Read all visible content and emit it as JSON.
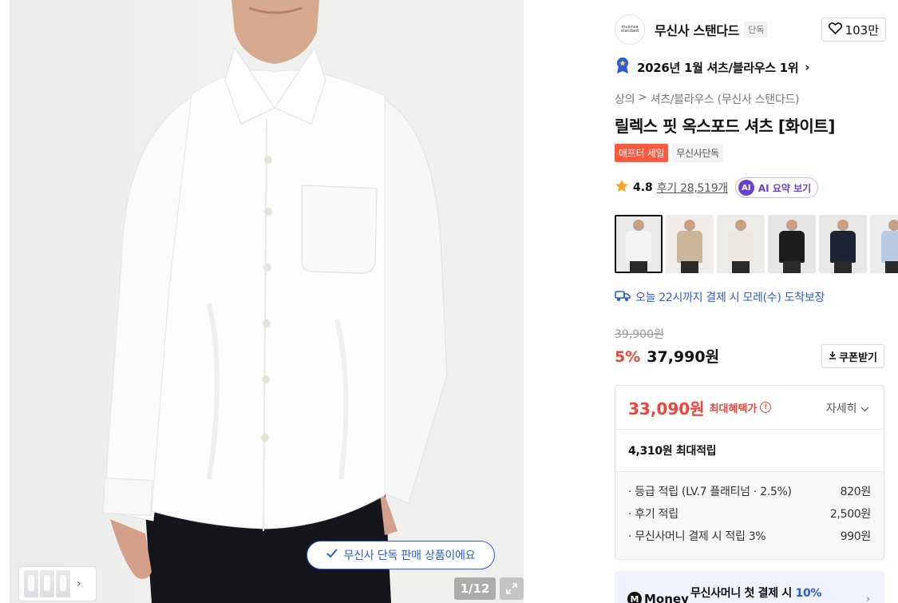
{
  "image": {
    "counter": "1/12",
    "exclusive_notice": "무신사 단독 판매 상품이에요"
  },
  "brand": {
    "logo_text_1": "musinsa",
    "logo_text_2": "standard",
    "name": "무신사 스탠다드",
    "badge": "단독",
    "likes": "103만"
  },
  "ranking": {
    "text": "2026년 1월 셔츠/블라우스 1위"
  },
  "breadcrumb": {
    "cat1": "상의",
    "sep": ">",
    "cat2": "셔츠/블라우스 (무신사 스탠다드)"
  },
  "product": {
    "title": "릴렉스 핏 옥스포드 셔츠 [화이트]",
    "tag_sale": "애프터 세일",
    "tag_exclusive": "무신사단독"
  },
  "rating": {
    "score": "4.8",
    "reviews": "후기 28,519개",
    "ai_icon": "AI",
    "ai_label": "AI 요약 보기"
  },
  "delivery": {
    "text": "오늘 22시까지 결제 시 모레(수) 도착보장"
  },
  "price": {
    "original": "39,900원",
    "discount": "5%",
    "current": "37,990원",
    "coupon_label": "쿠폰받기"
  },
  "benefit": {
    "max_price": "33,090원",
    "max_label": "최대혜택가",
    "info_icon": "!",
    "detail_label": "자세히",
    "points_total": "4,310원 최대적립",
    "items": [
      {
        "label": "· 등급 적립 (LV.7 플래티넘 · 2.5%)",
        "value": "820원"
      },
      {
        "label": "· 후기 적립",
        "value": "2,500원"
      },
      {
        "label": "· 무신사머니 결제 시 적립 3%",
        "value": "990원"
      }
    ]
  },
  "money_banner": {
    "logo": "Money",
    "logo_m": "M",
    "text": "무신사머니 첫 결제 시 ",
    "highlight": "10%"
  },
  "colors": {
    "accent_blue": "#2b5bdb",
    "sale_red": "#f0443a",
    "ai_purple": "#6a3fd6"
  },
  "swatches": [
    {
      "name": "white",
      "shirt": "#f4f4f4",
      "bg": "#e9eaea"
    },
    {
      "name": "beige",
      "shirt": "#cbb699",
      "bg": "#efecea"
    },
    {
      "name": "ivory",
      "shirt": "#ece7dc",
      "bg": "#ecebe8"
    },
    {
      "name": "black",
      "shirt": "#1c1c1c",
      "bg": "#e6e6e6"
    },
    {
      "name": "navy",
      "shirt": "#1b2536",
      "bg": "#e7e7e6"
    },
    {
      "name": "light-blue",
      "shirt": "#b9cbe2",
      "bg": "#ebeced"
    }
  ]
}
